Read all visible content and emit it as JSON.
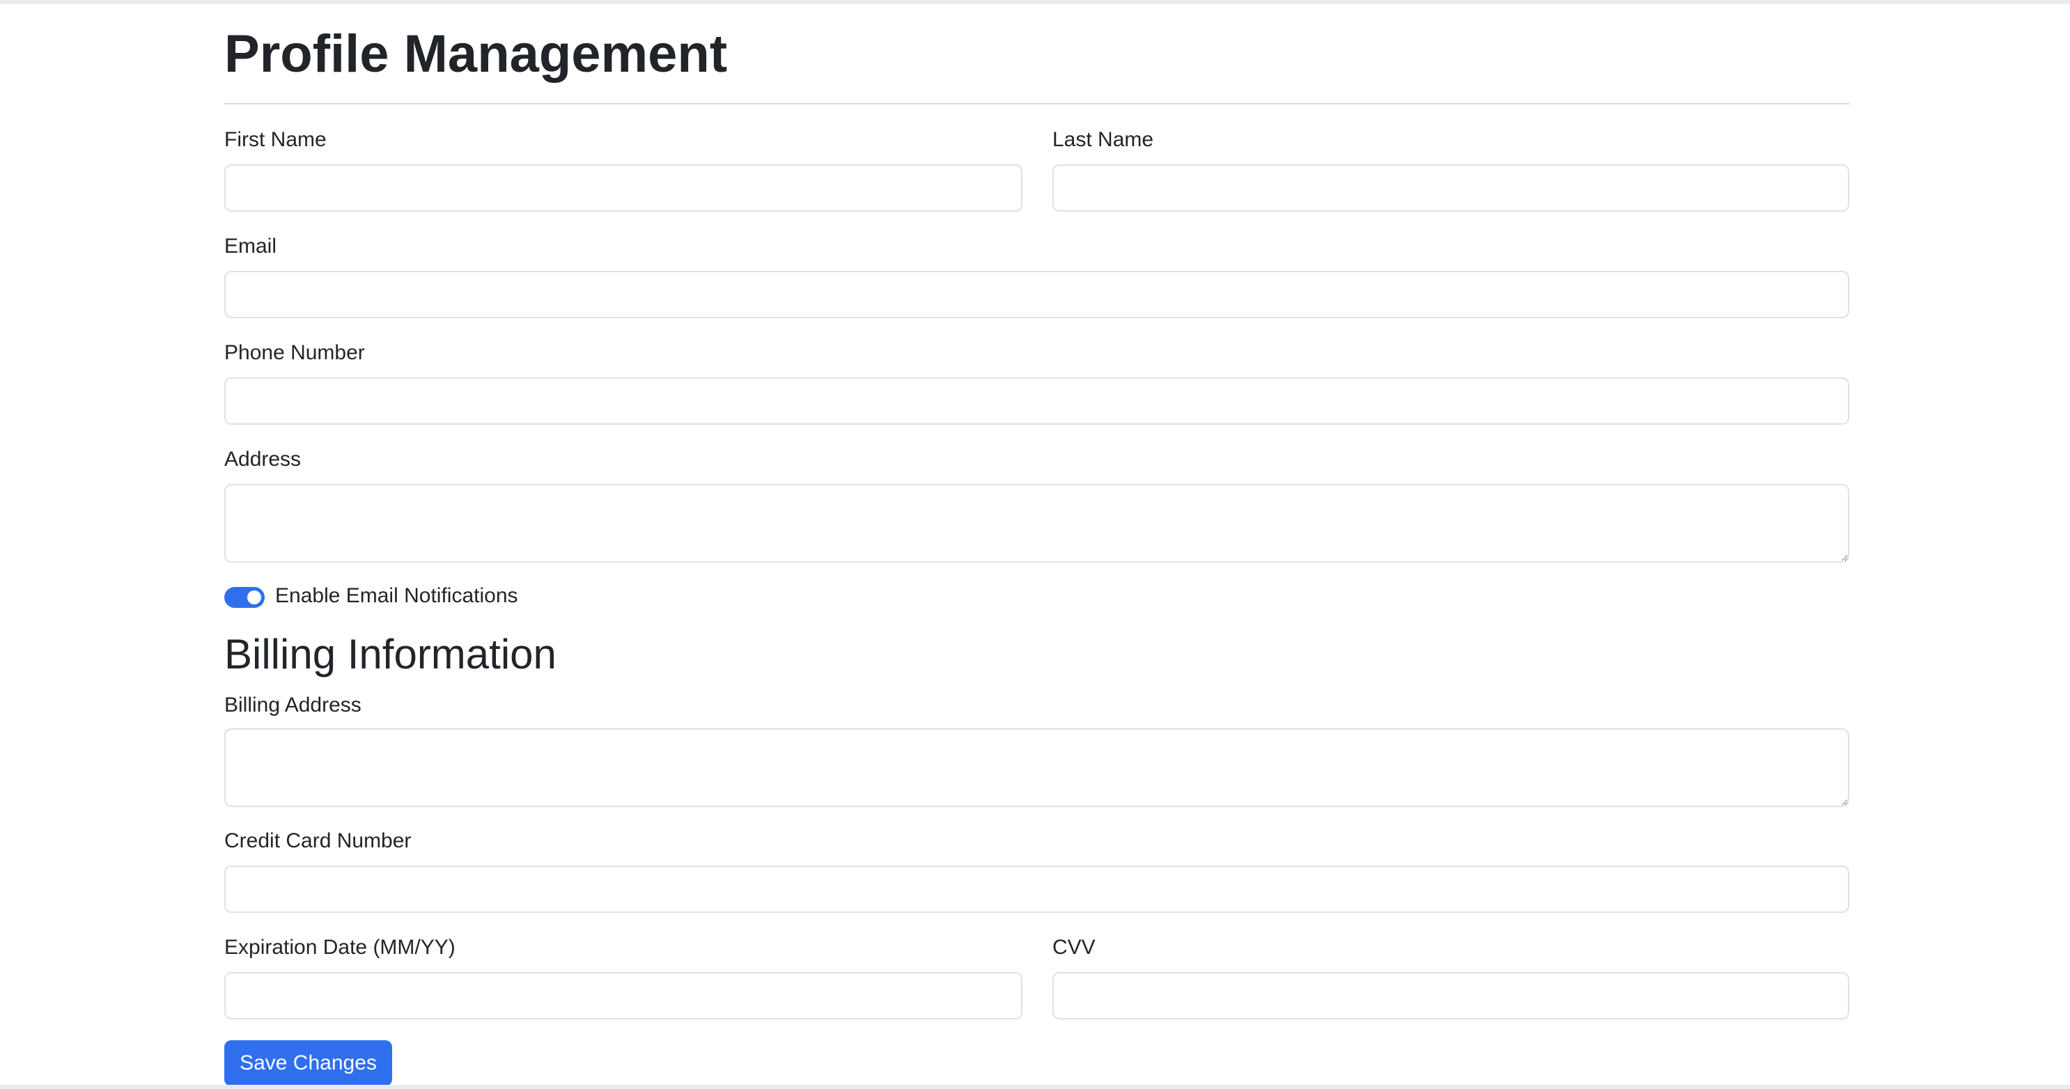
{
  "page": {
    "title": "Profile Management"
  },
  "profile": {
    "first_name": {
      "label": "First Name",
      "value": ""
    },
    "last_name": {
      "label": "Last Name",
      "value": ""
    },
    "email": {
      "label": "Email",
      "value": ""
    },
    "phone": {
      "label": "Phone Number",
      "value": ""
    },
    "address": {
      "label": "Address",
      "value": ""
    },
    "email_notifications": {
      "label": "Enable Email Notifications",
      "checked": true
    }
  },
  "billing": {
    "title": "Billing Information",
    "billing_address": {
      "label": "Billing Address",
      "value": ""
    },
    "card_number": {
      "label": "Credit Card Number",
      "value": ""
    },
    "expiration": {
      "label": "Expiration Date (MM/YY)",
      "value": ""
    },
    "cvv": {
      "label": "CVV",
      "value": ""
    }
  },
  "actions": {
    "save_label": "Save Changes"
  },
  "colors": {
    "accent": "#2f6fed",
    "text": "#212529",
    "border": "#dee2e6"
  }
}
